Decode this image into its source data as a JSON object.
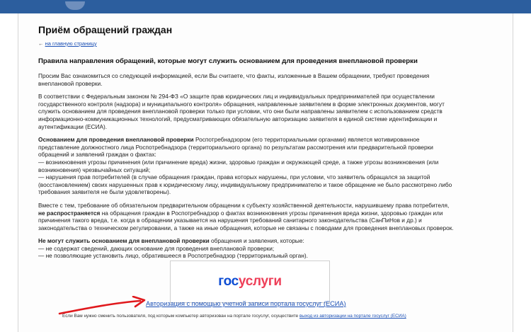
{
  "header": {
    "page_title": "Приём обращений граждан",
    "back_arrow": "←",
    "back_link": "на главную страницу"
  },
  "section": {
    "heading": "Правила направления обращений, которые могут служить основанием для проведения внеплановой проверки",
    "intro": "Просим Вас ознакомиться со следующей информацией, если Вы считаете, что факты, изложенные в Вашем обращении, требуют проведения внеплановой проверки.",
    "law_paragraph": "В соответствии с Федеральным законом № 294-ФЗ «О защите прав юридических лиц и индивидуальных предпринимателей при осуществлении государственного контроля (надзора) и муниципального контроля» обращения, направленные заявителем в форме электронных документов, могут служить основанием для проведения внеплановой проверки только при условии, что они были направлены заявителем с использованием средств информационно-коммуникационных технологий, предусматривающих обязательную авторизацию заявителя в единой системе идентификации и аутентификации (ЕСИА).",
    "basis_bold": "Основанием для проведения внеплановой проверки",
    "basis_text": " Роспотребнадзором (его территориальными органами) является мотивированное представление должностного лица Роспотребнадзора (территориального органа) по результатам рассмотрения или предварительной проверки обращений и заявлений граждан о фактах:",
    "basis_item_1": "— возникновения угрозы причинения (или причинение вреда) жизни, здоровью граждан и окружающей среде, а также угрозы возникновения (или возникновения) чрезвычайных ситуаций;",
    "basis_item_2": "— нарушения прав потребителей (в случае обращения граждан, права которых нарушены, при условии, что заявитель обращался за защитой (восстановлением) своих нарушенных прав к юридическому лицу, индивидуальному предпринимателю и такое обращение не было рассмотрено либо требования заявителя не были удовлетворены).",
    "prelim_text_1": "Вместе с тем, требование об обязательном предварительном обращении к субъекту хозяйственной деятельности, нарушившему права потребителя,",
    "prelim_bold": "не распространяется",
    "prelim_text_2": " на обращения граждан в Роспотребнадзор о фактах возникновения угрозы причинения вреда жизни, здоровью граждан или причинения такого вреда, т.е. когда в обращении указывается на нарушения требований санитарного законодательства (СанПиНов и др.) и законодательства о техническом регулировании, а также на иные обращения, которые не связаны с поводами для проведения внеплановых проверок.",
    "not_basis_bold": "Не могут служить основанием для внеплановой проверки",
    "not_basis_text": " обращения и заявления, которые:",
    "not_basis_item_1": "— не содержат сведений, дающих основание для проведения внеплановой проверки;",
    "not_basis_item_2": "— не позволяющие установить лицо, обратившееся в Роспотребнадзор (территориальный орган)."
  },
  "gosuslugi": {
    "logo_part_1": "гос",
    "logo_part_2": "услуги",
    "auth_link": "Авторизация с помощью учетной записи портала госуслуг (ЕСИА)"
  },
  "footer": {
    "note": "Если Вам нужно сменить пользователя, под которым компьютер авторизован на портале госуслуг, осуществите ",
    "exit_link": "выход из авторизации на портале госуслуг (ЕСИА)"
  },
  "colors": {
    "top_bar": "#2c5e9e",
    "link": "#1a4fb5",
    "arrow": "#e0191d",
    "logo_blue": "#0d4cd3",
    "logo_red": "#ee3f58"
  }
}
